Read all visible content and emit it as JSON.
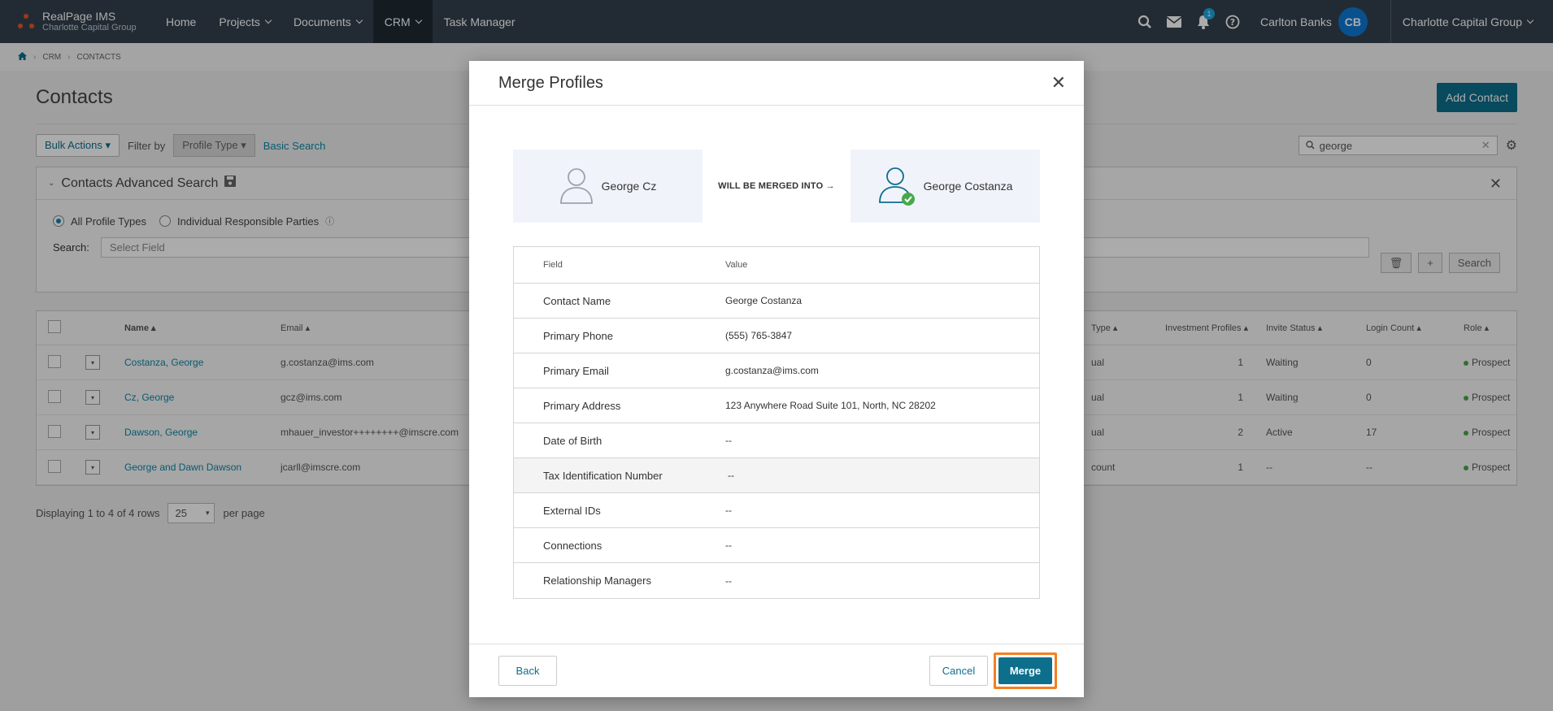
{
  "app": {
    "brand_name": "RealPage IMS",
    "brand_sub": "Charlotte Capital Group",
    "nav": [
      {
        "label": "Home"
      },
      {
        "label": "Projects"
      },
      {
        "label": "Documents"
      },
      {
        "label": "CRM"
      },
      {
        "label": "Task Manager"
      }
    ],
    "notification_count": "1",
    "user_name": "Carlton Banks",
    "user_initials": "CB",
    "org": "Charlotte Capital Group",
    "icons": [
      "search-icon",
      "mail-icon",
      "bell-icon",
      "help-icon"
    ]
  },
  "breadcrumb": [
    "CRM",
    "CONTACTS"
  ],
  "page": {
    "title": "Contacts",
    "add_contact": "Add Contact",
    "bulk_actions": "Bulk Actions",
    "filter_by": "Filter by",
    "profile_type": "Profile Type",
    "basic_search": "Basic Search",
    "search_value": "george"
  },
  "advanced_search": {
    "title": "Contacts Advanced Search",
    "radio_all": "All Profile Types",
    "radio_individual": "Individual Responsible Parties",
    "search_label": "Search:",
    "select_field": "Select Field",
    "search_button": "Search"
  },
  "table": {
    "headers": {
      "name": "Name",
      "email": "Email",
      "type": "Type",
      "investment_profiles": "Investment Profiles",
      "invite_status": "Invite Status",
      "login_count": "Login Count",
      "role": "Role"
    },
    "rows": [
      {
        "name": "Costanza, George",
        "email": "g.costanza@ims.com",
        "type": "ual",
        "investment_profiles": "1",
        "invite_status": "Waiting",
        "login_count": "0",
        "role": "Prospect"
      },
      {
        "name": "Cz, George",
        "email": "gcz@ims.com",
        "type": "ual",
        "investment_profiles": "1",
        "invite_status": "Waiting",
        "login_count": "0",
        "role": "Prospect"
      },
      {
        "name": "Dawson, George",
        "email": "mhauer_investor++++++++@imscre.com",
        "type": "ual",
        "investment_profiles": "2",
        "invite_status": "Active",
        "login_count": "17",
        "role": "Prospect"
      },
      {
        "name": "George and Dawn Dawson",
        "email": "jcarll@imscre.com",
        "type": "count",
        "investment_profiles": "1",
        "invite_status": "--",
        "login_count": "--",
        "role": "Prospect"
      }
    ],
    "footer_display": "Displaying 1 to 4 of 4 rows",
    "per_page_value": "25",
    "per_page_label": "per page"
  },
  "modal": {
    "title": "Merge Profiles",
    "source_name": "George Cz",
    "merge_label": "WILL BE MERGED INTO →",
    "target_name": "George Costanza",
    "field_header": "Field",
    "value_header": "Value",
    "fields": [
      {
        "field": "Contact Name",
        "value": "George Costanza"
      },
      {
        "field": "Primary Phone",
        "value": "(555) 765-3847"
      },
      {
        "field": "Primary Email",
        "value": "g.costanza@ims.com"
      },
      {
        "field": "Primary Address",
        "value": "123 Anywhere Road Suite 101, North, NC 28202"
      },
      {
        "field": "Date of Birth",
        "value": "--"
      },
      {
        "field": "Tax Identification Number",
        "value": "--"
      },
      {
        "field": "External IDs",
        "value": "--"
      },
      {
        "field": "Connections",
        "value": "--"
      },
      {
        "field": "Relationship Managers",
        "value": "--"
      }
    ],
    "back": "Back",
    "cancel": "Cancel",
    "merge": "Merge"
  },
  "colors": {
    "topbar": "#34414d",
    "accent": "#0d6f8c",
    "highlight": "#f57f20",
    "success": "#48a84a"
  }
}
